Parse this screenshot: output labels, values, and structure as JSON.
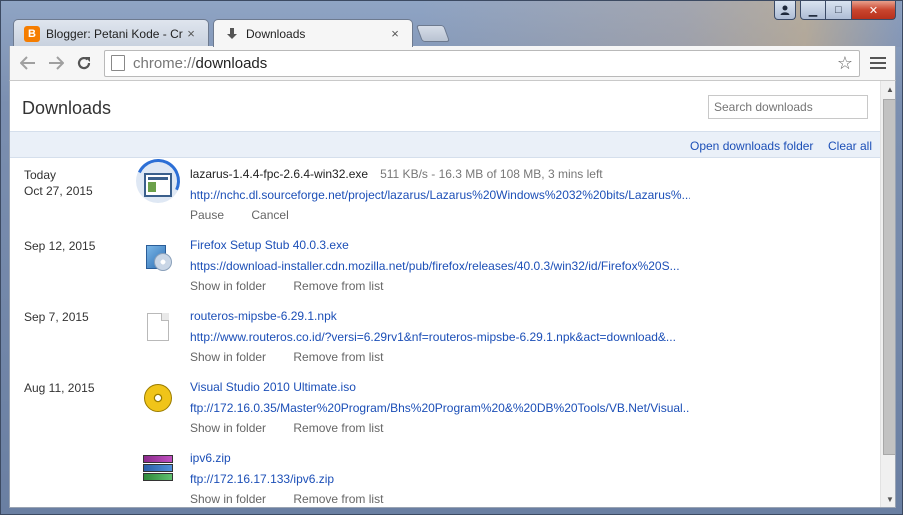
{
  "window": {
    "controls": {
      "minimize": "▁",
      "maximize": "□",
      "close": "✕"
    }
  },
  "tabs": [
    {
      "title": "Blogger: Petani Kode - Cr",
      "icon": "blogger-icon",
      "close": "×"
    },
    {
      "title": "Downloads",
      "icon": "download-arrow-icon",
      "close": "×"
    }
  ],
  "omnibox": {
    "scheme": "chrome://",
    "host": "downloads"
  },
  "page": {
    "title": "Downloads",
    "search_placeholder": "Search downloads",
    "open_folder_label": "Open downloads folder",
    "clear_all_label": "Clear all"
  },
  "downloads": [
    {
      "date_line1": "Today",
      "date_line2": "Oct 27, 2015",
      "name": "lazarus-1.4.4-fpc-2.6.4-win32.exe",
      "progress": "511 KB/s - 16.3 MB of 108 MB, 3 mins left",
      "progress_fraction": 0.15,
      "url": "http://nchc.dl.sourceforge.net/project/lazarus/Lazarus%20Windows%2032%20bits/Lazarus%...",
      "action1": "Pause",
      "action2": "Cancel",
      "icon": "exe-file-icon"
    },
    {
      "date_line1": "Sep 12, 2015",
      "name": "Firefox Setup Stub 40.0.3.exe",
      "url": "https://download-installer.cdn.mozilla.net/pub/firefox/releases/40.0.3/win32/id/Firefox%20S...",
      "action1": "Show in folder",
      "action2": "Remove from list",
      "icon": "installer-icon"
    },
    {
      "date_line1": "Sep 7, 2015",
      "name": "routeros-mipsbe-6.29.1.npk",
      "url": "http://www.routeros.co.id/?versi=6.29rv1&nf=routeros-mipsbe-6.29.1.npk&act=download&...",
      "action1": "Show in folder",
      "action2": "Remove from list",
      "icon": "document-icon"
    },
    {
      "date_line1": "Aug 11, 2015",
      "name": "Visual Studio 2010 Ultimate.iso",
      "url": "ftp://172.16.0.35/Master%20Program/Bhs%20Program%20&%20DB%20Tools/VB.Net/Visual...",
      "action1": "Show in folder",
      "action2": "Remove from list",
      "icon": "disc-icon"
    },
    {
      "name": "ipv6.zip",
      "url": "ftp://172.16.17.133/ipv6.zip",
      "action1": "Show in folder",
      "action2": "Remove from list",
      "icon": "archive-icon"
    }
  ]
}
